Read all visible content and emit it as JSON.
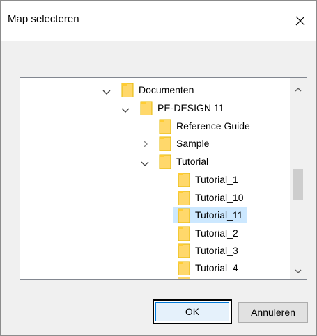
{
  "dialog": {
    "title": "Map selecteren"
  },
  "tree": {
    "nodes": [
      {
        "label": "Documenten",
        "expander": "expanded"
      },
      {
        "label": "PE-DESIGN 11",
        "expander": "expanded"
      },
      {
        "label": "Reference Guide",
        "expander": "none"
      },
      {
        "label": "Sample",
        "expander": "collapsed"
      },
      {
        "label": "Tutorial",
        "expander": "expanded"
      },
      {
        "label": "Tutorial_1",
        "expander": "none"
      },
      {
        "label": "Tutorial_10",
        "expander": "none"
      },
      {
        "label": "Tutorial_11",
        "expander": "none",
        "selected": true
      },
      {
        "label": "Tutorial_2",
        "expander": "none"
      },
      {
        "label": "Tutorial_3",
        "expander": "none"
      },
      {
        "label": "Tutorial_4",
        "expander": "none"
      }
    ],
    "selected": "Tutorial_11",
    "folder_color": "#ffd86b"
  },
  "buttons": {
    "ok": "OK",
    "cancel": "Annuleren"
  }
}
